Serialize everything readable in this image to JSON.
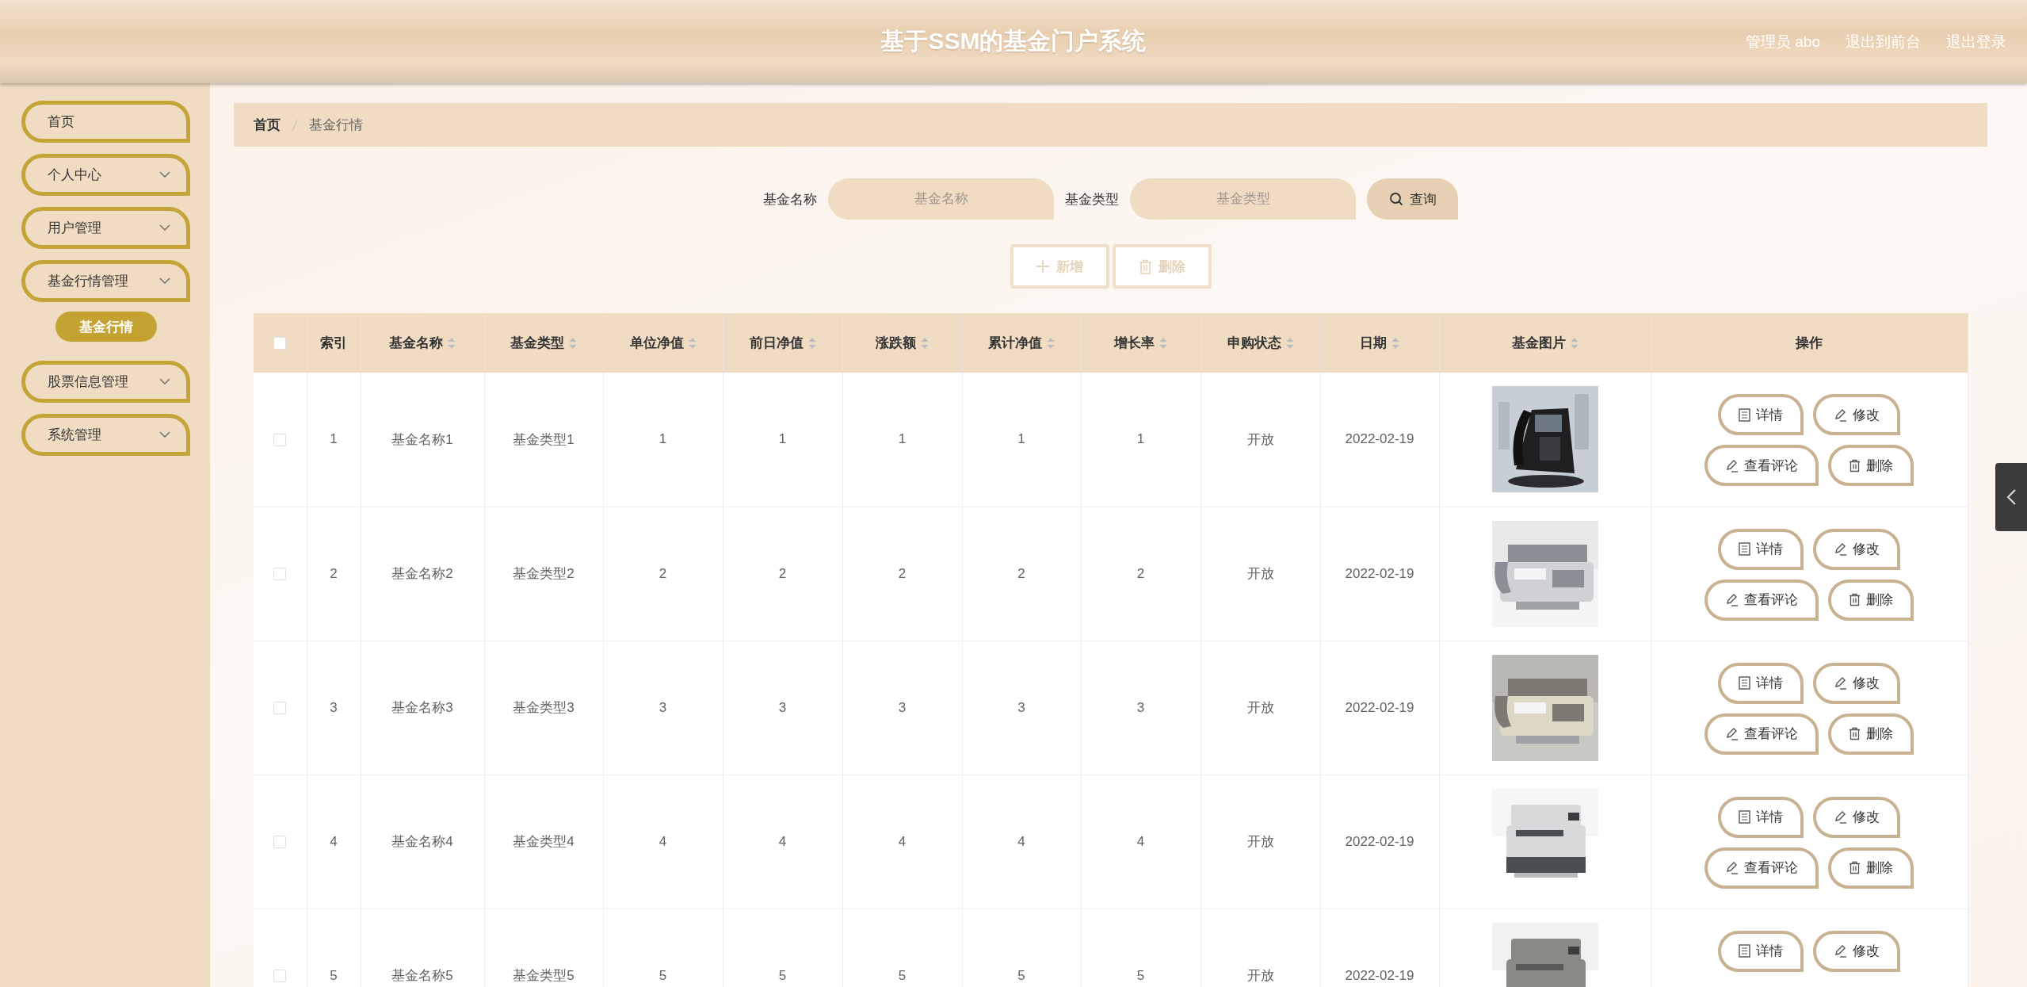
{
  "header": {
    "title": "基于SSM的基金门户系统",
    "user": "管理员 abo",
    "links": [
      "退出到前台",
      "退出登录"
    ]
  },
  "sidebar": {
    "items": [
      {
        "label": "首页",
        "kind": "link"
      },
      {
        "label": "个人中心",
        "kind": "submenu"
      },
      {
        "label": "用户管理",
        "kind": "submenu"
      },
      {
        "label": "基金行情管理",
        "kind": "submenu",
        "children": [
          {
            "label": "基金行情",
            "selected": true
          }
        ]
      },
      {
        "label": "股票信息管理",
        "kind": "submenu"
      },
      {
        "label": "系统管理",
        "kind": "submenu"
      }
    ]
  },
  "breadcrumb": [
    "首页",
    "基金行情"
  ],
  "search": {
    "fields": [
      {
        "label": "基金名称",
        "placeholder": "基金名称"
      },
      {
        "label": "基金类型",
        "placeholder": "基金类型"
      }
    ],
    "button": "查询"
  },
  "actions": [
    {
      "label": "新增",
      "kind": "add"
    },
    {
      "label": "删除",
      "kind": "delete"
    }
  ],
  "table": {
    "select_all": {
      "checked": false
    },
    "columns": [
      {
        "label": "索引",
        "sortable": false
      },
      {
        "label": "基金名称",
        "sortable": true
      },
      {
        "label": "基金类型",
        "sortable": true
      },
      {
        "label": "单位净值",
        "sortable": true
      },
      {
        "label": "前日净值",
        "sortable": true
      },
      {
        "label": "涨跌额",
        "sortable": true
      },
      {
        "label": "累计净值",
        "sortable": true
      },
      {
        "label": "增长率",
        "sortable": true
      },
      {
        "label": "申购状态",
        "sortable": true
      },
      {
        "label": "日期",
        "sortable": true
      },
      {
        "label": "基金图片",
        "sortable": true
      },
      {
        "label": "操作",
        "sortable": false
      }
    ],
    "rows": [
      {
        "selected": false,
        "cells": [
          "1",
          "基金名称1",
          "基金类型1",
          "1",
          "1",
          "1",
          "1",
          "1",
          "开放",
          "2022-02-19"
        ],
        "image": {
          "kind": "picture"
        },
        "actions": [
          {
            "label": "详情",
            "kind": "detail"
          },
          {
            "label": "修改",
            "kind": "edit"
          },
          {
            "label": "查看评论",
            "kind": "comment"
          },
          {
            "label": "删除",
            "kind": "delete"
          }
        ]
      },
      {
        "selected": false,
        "cells": [
          "2",
          "基金名称2",
          "基金类型2",
          "2",
          "2",
          "2",
          "2",
          "2",
          "开放",
          "2022-02-19"
        ],
        "image": {
          "kind": "picture"
        },
        "actions": [
          {
            "label": "详情",
            "kind": "detail"
          },
          {
            "label": "修改",
            "kind": "edit"
          },
          {
            "label": "查看评论",
            "kind": "comment"
          },
          {
            "label": "删除",
            "kind": "delete"
          }
        ]
      },
      {
        "selected": false,
        "cells": [
          "3",
          "基金名称3",
          "基金类型3",
          "3",
          "3",
          "3",
          "3",
          "3",
          "开放",
          "2022-02-19"
        ],
        "image": {
          "kind": "picture"
        },
        "actions": [
          {
            "label": "详情",
            "kind": "detail"
          },
          {
            "label": "修改",
            "kind": "edit"
          },
          {
            "label": "查看评论",
            "kind": "comment"
          },
          {
            "label": "删除",
            "kind": "delete"
          }
        ]
      },
      {
        "selected": false,
        "cells": [
          "4",
          "基金名称4",
          "基金类型4",
          "4",
          "4",
          "4",
          "4",
          "4",
          "开放",
          "2022-02-19"
        ],
        "image": {
          "kind": "picture"
        },
        "actions": [
          {
            "label": "详情",
            "kind": "detail"
          },
          {
            "label": "修改",
            "kind": "edit"
          },
          {
            "label": "查看评论",
            "kind": "comment"
          },
          {
            "label": "删除",
            "kind": "delete"
          }
        ]
      },
      {
        "selected": false,
        "cells": [
          "5",
          "基金名称5",
          "基金类型5",
          "5",
          "5",
          "5",
          "5",
          "5",
          "开放",
          "2022-02-19"
        ],
        "image": {
          "kind": "picture"
        },
        "actions": [
          {
            "label": "详情",
            "kind": "detail"
          },
          {
            "label": "修改",
            "kind": "edit"
          }
        ]
      }
    ]
  }
}
